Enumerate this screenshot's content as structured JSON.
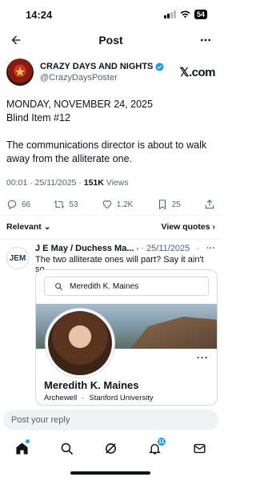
{
  "status_bar": {
    "time": "14:24",
    "battery": "54"
  },
  "header": {
    "title": "Post"
  },
  "author": {
    "name": "CRAZY DAYS AND NIGHTS",
    "handle": "@CrazyDaysPoster",
    "platform_logo": "𝕏.com"
  },
  "tweet": {
    "line1": "MONDAY, NOVEMBER 24, 2025",
    "line2": "Blind Item #12",
    "body": "The communications director is about to walk away from the alliterate one."
  },
  "meta": {
    "time": "00:01",
    "date": "25/11/2025",
    "views_count": "151K",
    "views_label": "Views",
    "sep1": " · ",
    "sep2": " · "
  },
  "actions": {
    "replies": "66",
    "reposts": "53",
    "likes": "1.2K",
    "bookmarks": "25"
  },
  "sort": {
    "relevant": "Relevant",
    "view_quotes": "View quotes"
  },
  "reply": {
    "avatar_text": "JEM",
    "name": "J E May / Duchess Ma...",
    "date": "· 25/11/2025",
    "text": "The two alliterate ones will part? Say it ain't so."
  },
  "card": {
    "search_text": "Meredith K. Maines",
    "name": "Meredith K. Maines",
    "org": "Archewell",
    "sep": "·",
    "school": "Stanford University"
  },
  "reply_input": {
    "placeholder": "Post your reply"
  },
  "tabbar": {
    "notifications_badge": "11"
  },
  "colors": {
    "accent": "#1d9bf0",
    "text": "#0f1419",
    "muted": "#536471"
  }
}
